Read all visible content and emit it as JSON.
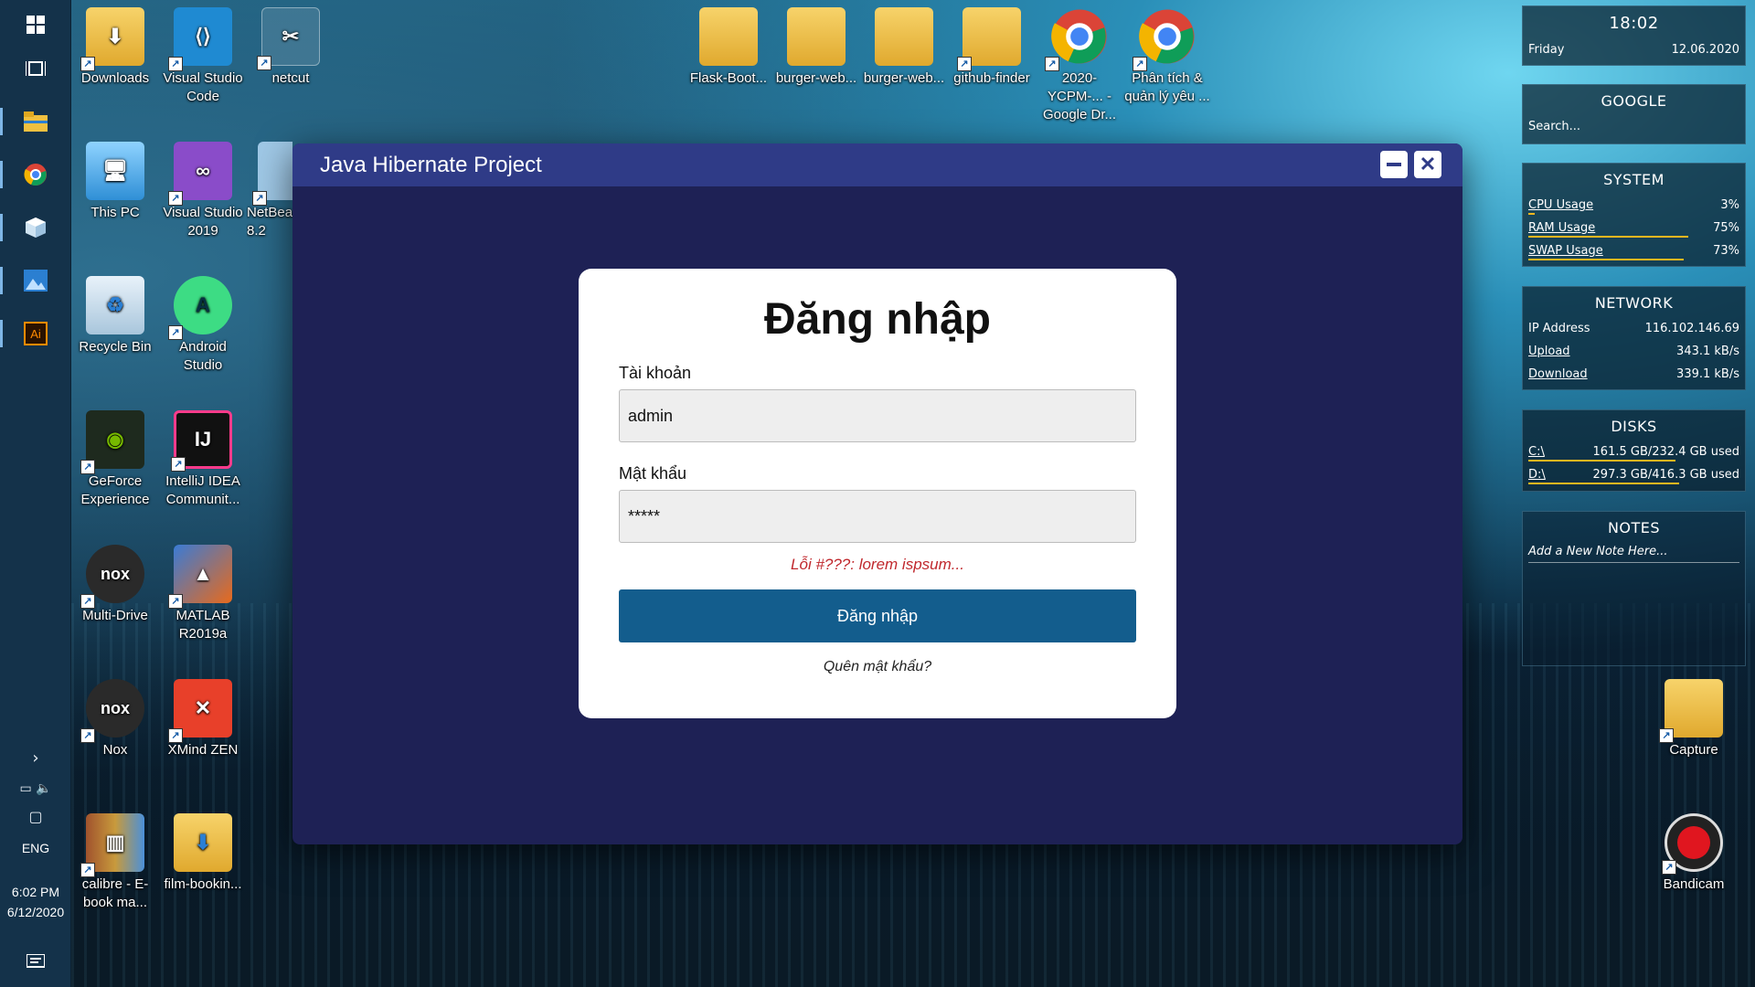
{
  "window": {
    "title": "Java Hibernate Project",
    "minimize_icon": "minimize-icon",
    "close_icon": "close-icon"
  },
  "login": {
    "heading": "Đăng nhập",
    "username_label": "Tài khoản",
    "username_value": "admin",
    "password_label": "Mật khẩu",
    "password_value": "*****",
    "error_message": "Lỗi #???: lorem ispsum...",
    "submit_label": "Đăng nhập",
    "forgot_label": "Quên mật khẩu?"
  },
  "colors": {
    "window_bg": "#1e2155",
    "titlebar": "#2f3b87",
    "submit": "#135d8d",
    "error": "#c0282d"
  },
  "desktop": {
    "icons": [
      {
        "label": "Downloads"
      },
      {
        "label": "Visual Studio Code"
      },
      {
        "label": "netcut"
      },
      {
        "label": "This PC"
      },
      {
        "label": "Visual Studio 2019"
      },
      {
        "label": "NetBea 8.2"
      },
      {
        "label": "Recycle Bin"
      },
      {
        "label": "Android Studio"
      },
      {
        "label": "GeForce Experience"
      },
      {
        "label": "IntelliJ IDEA Communit..."
      },
      {
        "label": "Multi-Drive"
      },
      {
        "label": "MATLAB R2019a"
      },
      {
        "label": "Nox"
      },
      {
        "label": "XMind ZEN"
      },
      {
        "label": "calibre - E-book ma..."
      },
      {
        "label": "film-bookin..."
      },
      {
        "label": "Flask-Boot..."
      },
      {
        "label": "burger-web..."
      },
      {
        "label": "burger-web..."
      },
      {
        "label": "github-finder"
      },
      {
        "label": "2020-YCPM-... - Google Dr..."
      },
      {
        "label": "Phân tích & quản lý yêu ..."
      },
      {
        "label": "Capture"
      },
      {
        "label": "Bandicam"
      }
    ]
  },
  "taskbar": {
    "language": "ENG",
    "time": "6:02 PM",
    "date": "6/12/2020"
  },
  "widgets": {
    "clock": {
      "time": "18:02",
      "day": "Friday",
      "date": "12.06.2020"
    },
    "google": {
      "title": "GOOGLE",
      "placeholder": "Search..."
    },
    "system": {
      "title": "SYSTEM",
      "rows": [
        {
          "label": "CPU Usage",
          "value": "3%",
          "level": 0.03
        },
        {
          "label": "RAM Usage",
          "value": "75%",
          "level": 0.75
        },
        {
          "label": "SWAP Usage",
          "value": "73%",
          "level": 0.73
        }
      ]
    },
    "network": {
      "title": "NETWORK",
      "rows": [
        {
          "label": "IP Address",
          "value": "116.102.146.69"
        },
        {
          "label": "Upload",
          "value": "343.1 kB/s"
        },
        {
          "label": "Download",
          "value": "339.1 kB/s"
        }
      ]
    },
    "disks": {
      "title": "DISKS",
      "rows": [
        {
          "label": "C:\\",
          "value": "161.5 GB/232.4 GB used",
          "level": 0.69
        },
        {
          "label": "D:\\",
          "value": "297.3 GB/416.3 GB used",
          "level": 0.71
        }
      ]
    },
    "notes": {
      "title": "NOTES",
      "placeholder": "Add a New Note Here..."
    }
  }
}
